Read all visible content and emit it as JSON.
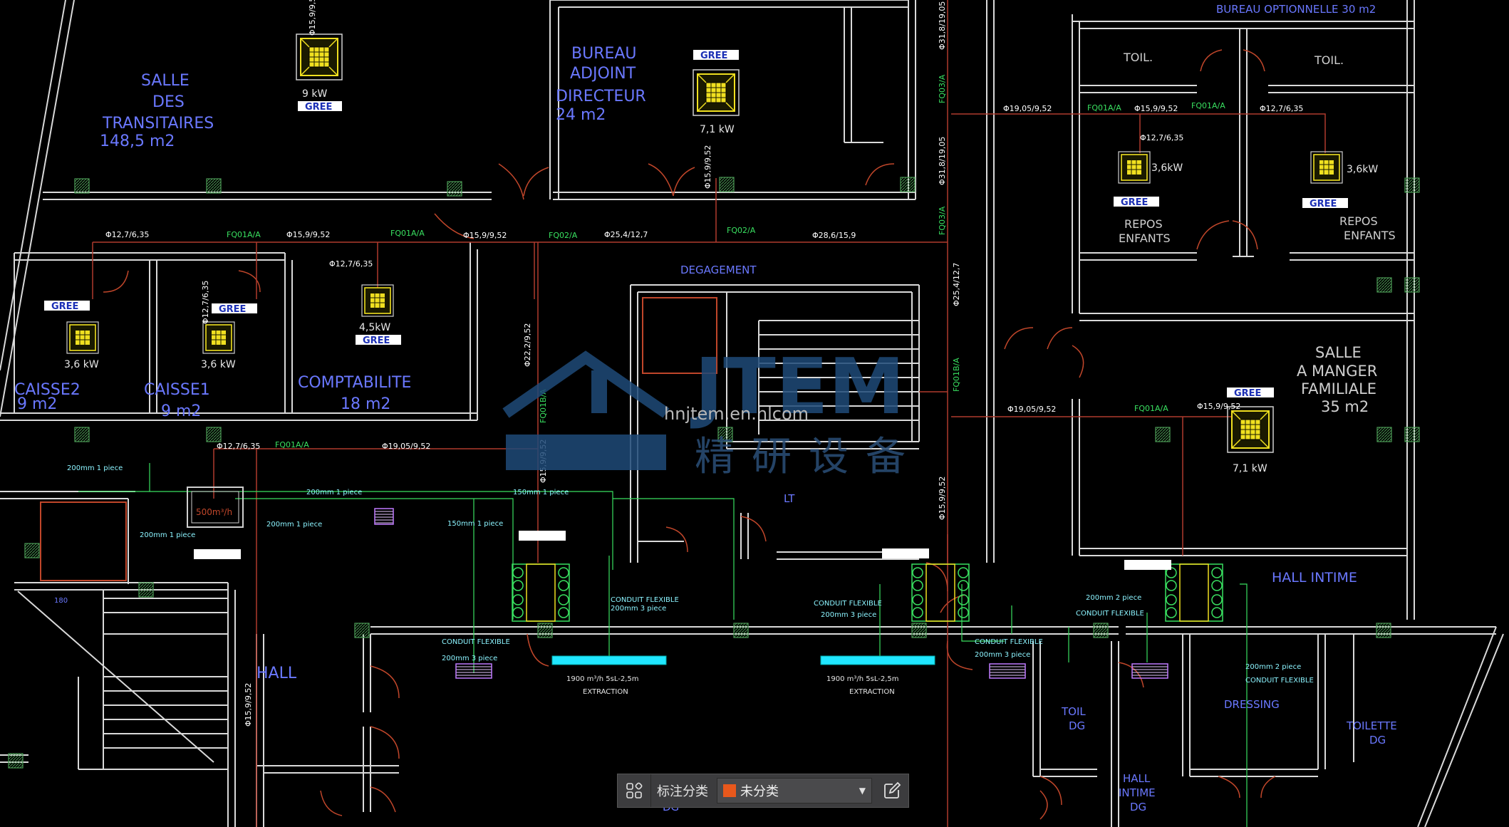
{
  "rooms": {
    "salle_transitaires": [
      "SALLE",
      "DES",
      "TRANSITAIRES",
      "148,5  m2"
    ],
    "bureau_adjoint": [
      "BUREAU",
      "ADJOINT",
      "DIRECTEUR",
      "24  m2"
    ],
    "bureau_optionnelle": "BUREAU OPTIONNELLE 30  m2",
    "toil_left": "TOIL.",
    "toil_right": "TOIL.",
    "repos_enfants_1": [
      "REPOS",
      "ENFANTS"
    ],
    "repos_enfants_2": [
      "REPOS",
      "ENFANTS"
    ],
    "degagement": "DEGAGEMENT",
    "caisse2": [
      "CAISSE2",
      "9  m2"
    ],
    "caisse1": [
      "CAISSE1",
      "9  m2"
    ],
    "comptabilite": [
      "COMPTABILITE",
      "18  m2"
    ],
    "salle_manger": [
      "SALLE",
      "A MANGER",
      "FAMILIALE",
      "35  m2"
    ],
    "lt": "LT",
    "hall": "HALL",
    "hall_intime": "HALL INTIME",
    "toil_dg": [
      "TOIL",
      "DG"
    ],
    "hall_intime_dg": [
      "HALL",
      "INTIME",
      "DG"
    ],
    "dressing": "DRESSING",
    "toilette_dg": [
      "TOILETTE",
      "DG"
    ],
    "dg_bottom": "DG"
  },
  "units": {
    "u1": {
      "brand": "GREE",
      "power": "9  kW"
    },
    "u2": {
      "brand": "GREE",
      "power": "7,1  kW"
    },
    "u3": {
      "brand": "GREE",
      "power": "3,6 kW"
    },
    "u4": {
      "brand": "GREE",
      "power": "3,6 kW"
    },
    "u5": {
      "brand": "GREE",
      "power": "3,6kW"
    },
    "u6": {
      "brand": "GREE",
      "power": "3,6kW"
    },
    "u7": {
      "brand": "GREE",
      "power": "4,5kW"
    },
    "u8": {
      "brand": "GREE",
      "power": "7,1  kW"
    }
  },
  "pipe_labels": {
    "p1": "Φ12,7/6,35",
    "p2": "FQ01A/A",
    "p3": "Φ15,9/9,52",
    "p4": "FQ01A/A",
    "p5": "Φ15,9/9,52",
    "p6": "FQ02/A",
    "p7": "Φ25,4/12,7",
    "p8": "FQ02/A",
    "p9": "Φ28,6/15,9",
    "p10": "Φ12,7/6,35",
    "p11": "Φ19,05/9,52",
    "p12": "FQ01A/A",
    "p13": "Φ15,9/9,52",
    "p14": "FQ01A/A",
    "p15": "Φ12,7/6,35",
    "p16": "Φ12,7/6,35",
    "p17": "Φ19,05/9,52",
    "p18": "FQ01A/A",
    "p19": "Φ15,9/9,52",
    "p20": "Φ12,7/6,35",
    "p21": "FQ01A/A",
    "p22": "Φ19,05/9,52",
    "v1": "Φ15,9/9,52",
    "v2": "Φ31,8/19,05",
    "v3": "FQ03/A",
    "v4": "Φ31,8/19,05",
    "v5": "FQ03/A",
    "v6": "Φ25,4/12,7",
    "v7": "FQ01B/A",
    "v8": "Φ15,9/9,52",
    "v9": "Φ22,2/9,52",
    "v10": "FQ01B/A",
    "v11": "Φ15,9/9,52",
    "v12": "Φ15,9/9,52",
    "v13": "Φ12,7/6,35",
    "v14": "Φ15,9/9,52"
  },
  "duct_labels": {
    "d1": "200mm 1 piece",
    "d2": "200mm 1 piece",
    "d3": "200mm 1 piece",
    "d4": "200mm 1 piece",
    "d5": "150mm 1 piece",
    "d6": "150mm 1 piece",
    "d7": "CONDUIT FLEXIBLE",
    "d8": "200mm 3 piece",
    "d9": "CONDUIT FLEXIBLE",
    "d10": "200mm 3 piece",
    "d11": "CONDUIT FLEXIBLE",
    "d12": "200mm 3 piece",
    "d13": "CONDUIT FLEXIBLE",
    "d14": "200mm 3 piece",
    "d15": "200mm 2 piece",
    "d16": "CONDUIT FLEXIBLE",
    "d17": "200mm 2 piece",
    "d18": "CONDUIT FLEXIBLE",
    "flow": "500m³/h",
    "ext1a": "1900 m³/h  5sL-2,5m",
    "ext1b": "EXTRACTION",
    "ext2a": "1900 m³/h  5sL-2,5m",
    "ext2b": "EXTRACTION",
    "dim180": "180"
  },
  "watermark": {
    "brand": "JTEM",
    "url": "hnjtem.en.hlcom",
    "cn": "精研设备"
  },
  "toolbar": {
    "label": "标注分类",
    "selected": "未分类",
    "swatch_color": "#e8581c"
  },
  "colors": {
    "wall": "#d9d9d9",
    "door": "#c0462a",
    "pipe": "#b03a2e",
    "duct": "#3ad04a",
    "grille": "#2f6b3a",
    "cassette": "#f0e020",
    "brand_bg": "#ffffff",
    "brand_text": "#1b2fb5"
  }
}
